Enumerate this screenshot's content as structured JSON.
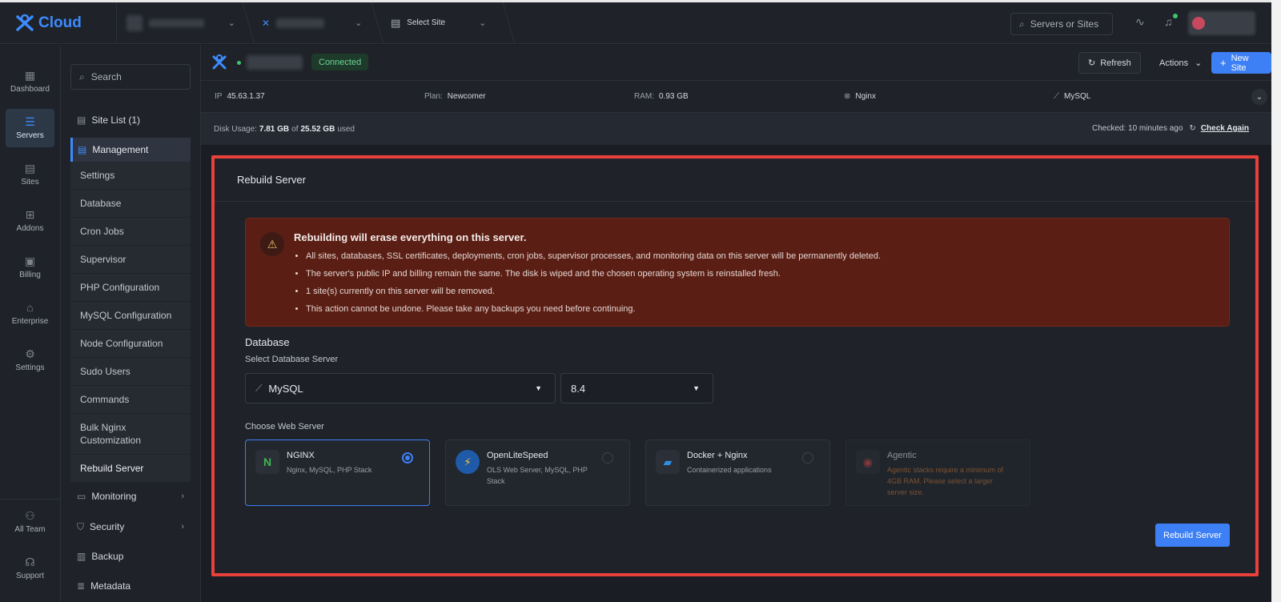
{
  "app": {
    "logo_text": "Cloud"
  },
  "topbar": {
    "site_select_label": "Select Site",
    "search_placeholder": "Servers or Sites"
  },
  "rail": [
    {
      "label": "Dashboard",
      "icon": "dashboard-icon"
    },
    {
      "label": "Servers",
      "icon": "servers-icon"
    },
    {
      "label": "Sites",
      "icon": "sites-icon"
    },
    {
      "label": "Addons",
      "icon": "addons-icon"
    },
    {
      "label": "Billing",
      "icon": "billing-icon"
    },
    {
      "label": "Enterprise",
      "icon": "enterprise-icon"
    },
    {
      "label": "Settings",
      "icon": "settings-icon"
    },
    {
      "label": "All Team",
      "icon": "team-icon"
    },
    {
      "label": "Support",
      "icon": "support-icon"
    }
  ],
  "subnav": {
    "search_placeholder": "Search",
    "site_list": "Site List (1)",
    "management": "Management",
    "items": [
      "Settings",
      "Database",
      "Cron Jobs",
      "Supervisor",
      "PHP Configuration",
      "MySQL Configuration",
      "Node Configuration",
      "Sudo Users",
      "Commands",
      "Bulk Nginx Customization",
      "Rebuild Server"
    ],
    "monitoring": "Monitoring",
    "security": "Security",
    "backup": "Backup",
    "metadata": "Metadata"
  },
  "server": {
    "status": "Connected",
    "refresh_label": "Refresh",
    "actions_label": "Actions",
    "new_site_label": "New Site",
    "ip_label": "IP",
    "ip_value": "45.63.1.37",
    "plan_label": "Plan:",
    "plan_value": "Newcomer",
    "ram_label": "RAM:",
    "ram_value": "0.93 GB",
    "web_server": "Nginx",
    "db_server": "MySQL",
    "disk_prefix": "Disk Usage:",
    "disk_used": "7.81 GB",
    "disk_of": "of",
    "disk_total": "25.52 GB",
    "disk_suffix": "used",
    "checked": "Checked: 10 minutes ago",
    "check_again": "Check Again"
  },
  "rebuild": {
    "title": "Rebuild Server",
    "warning_title": "Rebuilding will erase everything on this server.",
    "warnings": [
      "All sites, databases, SSL certificates, deployments, cron jobs, supervisor processes, and monitoring data on this server will be permanently deleted.",
      "The server's public IP and billing remain the same. The disk is wiped and the chosen operating system is reinstalled fresh.",
      "1 site(s) currently on this server will be removed.",
      "This action cannot be undone. Please take any backups you need before continuing."
    ],
    "database_heading": "Database",
    "db_select_label": "Select Database Server",
    "db_value": "MySQL",
    "db_version": "8.4",
    "web_heading": "Choose Web Server",
    "cards": [
      {
        "name": "NGINX",
        "desc": "Nginx, MySQL, PHP Stack",
        "logo": "N",
        "color": "#3fb350"
      },
      {
        "name": "OpenLiteSpeed",
        "desc": "OLS Web Server, MySQL, PHP Stack",
        "logo": "⚡",
        "color": "#f2c230"
      },
      {
        "name": "Docker + Nginx",
        "desc": "Containerized applications",
        "logo": "▰",
        "color": "#2f8fe6"
      },
      {
        "name": "Agentic",
        "desc": "Agentic stacks require a minimum of 4GB RAM. Please select a larger server size.",
        "logo": "◉",
        "color": "#d94a4a"
      }
    ],
    "submit_label": "Rebuild Server"
  }
}
